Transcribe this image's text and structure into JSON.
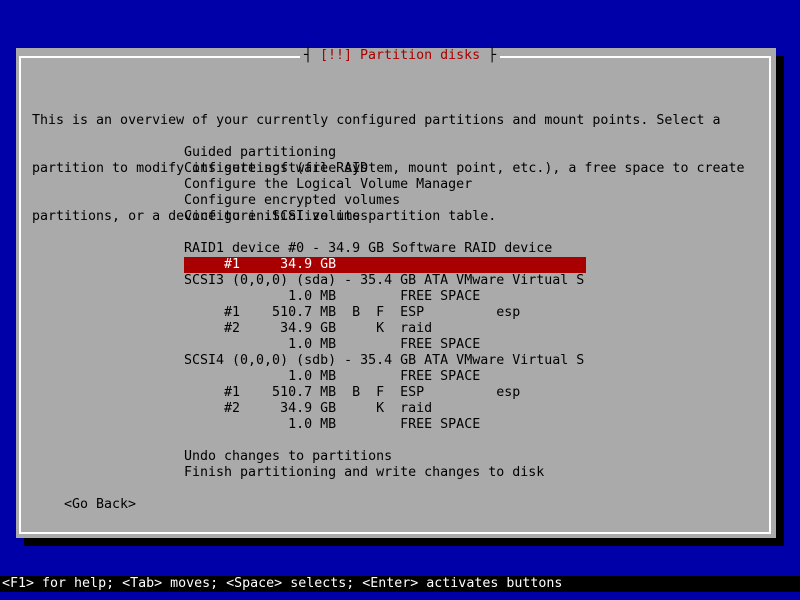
{
  "dialog": {
    "title_left": "┤ ",
    "title": "[!!] Partition disks",
    "title_right": " ├",
    "intro": [
      "This is an overview of your currently configured partitions and mount points. Select a",
      "partition to modify its settings (file system, mount point, etc.), a free space to create",
      "partitions, or a device to initialize its partition table."
    ]
  },
  "menu": {
    "guided": "Guided partitioning",
    "software_raid": "Configure software RAID",
    "lvm": "Configure the Logical Volume Manager",
    "encrypted": "Configure encrypted volumes",
    "iscsi": "Configure iSCSI volumes",
    "raid_device": "RAID1 device #0 - 34.9 GB Software RAID device",
    "raid_partition": "     #1     34.9 GB                                ",
    "sda_device": "SCSI3 (0,0,0) (sda) - 35.4 GB ATA VMware Virtual S",
    "sda_free1": "             1.0 MB        FREE SPACE",
    "sda_part1": "     #1    510.7 MB  B  F  ESP         esp",
    "sda_part2": "     #2     34.9 GB     K  raid",
    "sda_free2": "             1.0 MB        FREE SPACE",
    "sdb_device": "SCSI4 (0,0,0) (sdb) - 35.4 GB ATA VMware Virtual S",
    "sdb_free1": "             1.0 MB        FREE SPACE",
    "sdb_part1": "     #1    510.7 MB  B  F  ESP         esp",
    "sdb_part2": "     #2     34.9 GB     K  raid",
    "sdb_free2": "             1.0 MB        FREE SPACE",
    "undo": "Undo changes to partitions",
    "finish": "Finish partitioning and write changes to disk"
  },
  "buttons": {
    "go_back": "<Go Back>"
  },
  "footer": {
    "help": "<F1> for help; <Tab> moves; <Space> selects; <Enter> activates buttons"
  },
  "colors": {
    "background": "#0000a8",
    "dialog": "#aaaaaa",
    "title": "#a80000",
    "selection": "#a80000"
  }
}
